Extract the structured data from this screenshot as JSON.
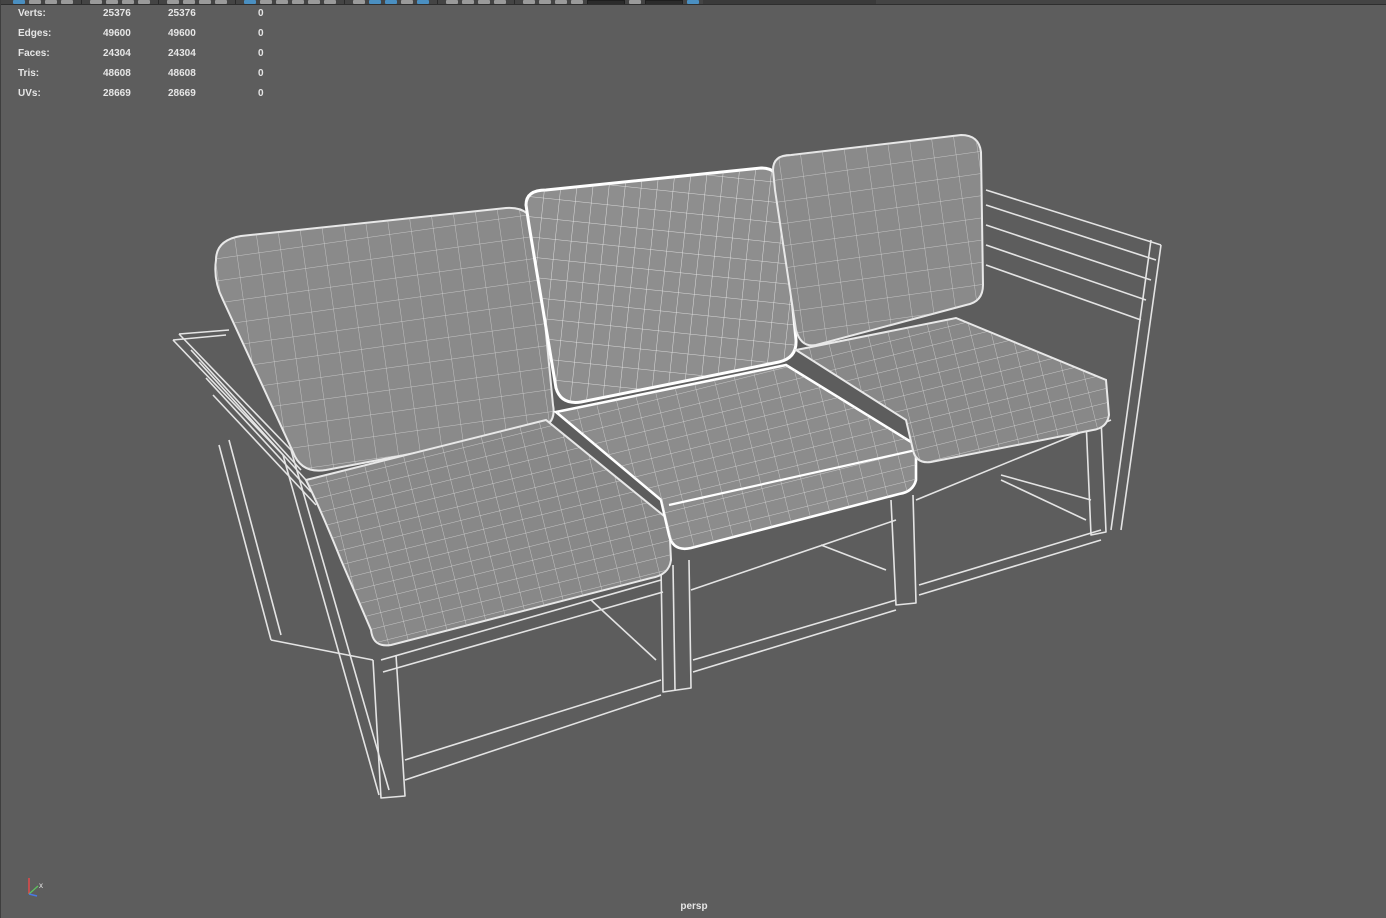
{
  "hud": {
    "rows": [
      {
        "label": "Verts:",
        "v1": "25376",
        "v2": "25376",
        "v3": "0"
      },
      {
        "label": "Edges:",
        "v1": "49600",
        "v2": "49600",
        "v3": "0"
      },
      {
        "label": "Faces:",
        "v1": "24304",
        "v2": "24304",
        "v3": "0"
      },
      {
        "label": "Tris:",
        "v1": "48608",
        "v2": "48608",
        "v3": "0"
      },
      {
        "label": "UVs:",
        "v1": "28669",
        "v2": "28669",
        "v3": "0"
      }
    ]
  },
  "camera": {
    "label": "persp"
  },
  "gizmo": {
    "x_label": "x",
    "colors": {
      "x": "#e34a4a",
      "y": "#5ec75e",
      "z": "#4a79e3"
    }
  },
  "colors": {
    "background": "#5d5d5d",
    "wire": "#e8e8e8",
    "cushion_fill": "#8a8a8a",
    "selected_wire": "#ffffff"
  }
}
